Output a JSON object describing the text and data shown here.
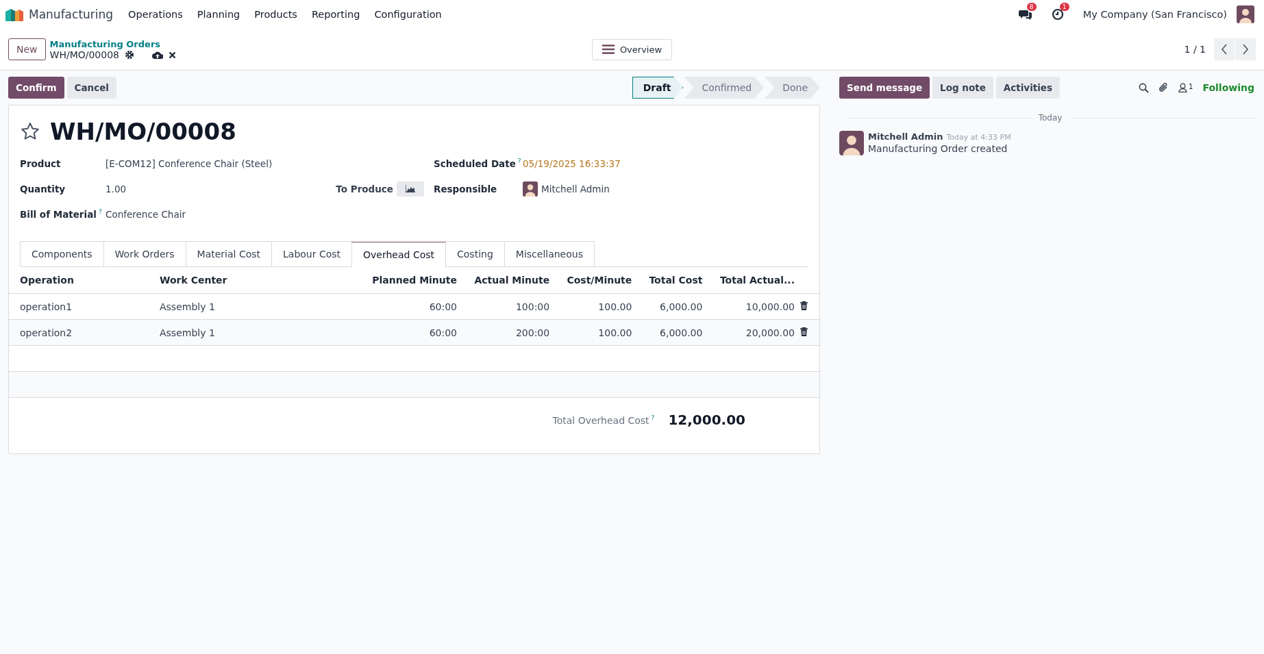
{
  "navbar": {
    "app_name": "Manufacturing",
    "menu": [
      "Operations",
      "Planning",
      "Products",
      "Reporting",
      "Configuration"
    ],
    "messages_badge": "8",
    "activities_badge": "1",
    "company": "My Company (San Francisco)"
  },
  "control_panel": {
    "new_button": "New",
    "breadcrumb_parent": "Manufacturing Orders",
    "breadcrumb_current": "WH/MO/00008",
    "overview_button": "Overview",
    "pager": "1 / 1"
  },
  "actions": [
    {
      "label": "Confirm",
      "kind": "primary"
    },
    {
      "label": "Cancel",
      "kind": "secondary"
    }
  ],
  "statusbar": [
    {
      "label": "Draft",
      "selected": true
    },
    {
      "label": "Confirmed",
      "selected": false
    },
    {
      "label": "Done",
      "selected": false
    }
  ],
  "form": {
    "title": "WH/MO/00008",
    "starred": false,
    "left_fields": [
      {
        "label": "Product",
        "value": "[E-COM12] Conference Chair (Steel)"
      },
      {
        "label": "Quantity",
        "value": "1.00"
      },
      {
        "label": "Bill of Material",
        "help": "?",
        "value": "Conference Chair"
      }
    ],
    "to_produce": "To Produce",
    "right_fields": [
      {
        "label": "Scheduled Date",
        "help": "?",
        "value": "05/19/2025 16:33:37",
        "kind": "date"
      },
      {
        "label": "Responsible",
        "value": "Mitchell Admin",
        "kind": "user"
      }
    ]
  },
  "tabs": [
    {
      "label": "Components",
      "selected": false
    },
    {
      "label": "Work Orders",
      "selected": false
    },
    {
      "label": "Material Cost",
      "selected": false
    },
    {
      "label": "Labour Cost",
      "selected": false
    },
    {
      "label": "Overhead Cost",
      "selected": true
    },
    {
      "label": "Costing",
      "selected": false
    },
    {
      "label": "Miscellaneous",
      "selected": false
    }
  ],
  "table": {
    "columns": [
      "Operation",
      "Work Center",
      "Planned Minute",
      "Actual Minute",
      "Cost/Minute",
      "Total Cost",
      "Total Actual..."
    ],
    "rows": [
      {
        "cells": [
          "operation1",
          "Assembly 1",
          "60:00",
          "100:00",
          "100.00",
          "6,000.00",
          "10,000.00"
        ]
      },
      {
        "cells": [
          "operation2",
          "Assembly 1",
          "60:00",
          "200:00",
          "100.00",
          "6,000.00",
          "20,000.00"
        ]
      }
    ],
    "total_label": "Total Overhead Cost",
    "total_help": "?",
    "total_value": "12,000.00"
  },
  "chatter": {
    "buttons": [
      {
        "label": "Send message",
        "kind": "primary"
      },
      {
        "label": "Log note",
        "kind": "secondary"
      },
      {
        "label": "Activities",
        "kind": "secondary"
      }
    ],
    "followers_count": "1",
    "following": "Following",
    "date_separator": "Today",
    "messages": [
      {
        "author": "Mitchell Admin",
        "time": "Today at 4:33 PM",
        "body": "Manufacturing Order created"
      }
    ]
  }
}
